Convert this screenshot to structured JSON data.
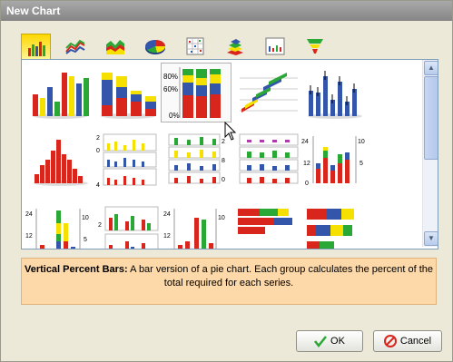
{
  "window": {
    "title": "New Chart"
  },
  "tabs": [
    {
      "name": "bar-chart-icon",
      "active": true
    },
    {
      "name": "line-chart-icon"
    },
    {
      "name": "area-chart-icon"
    },
    {
      "name": "pie-chart-icon"
    },
    {
      "name": "scatter-chart-icon"
    },
    {
      "name": "stock-chart-icon"
    },
    {
      "name": "range-chart-icon"
    },
    {
      "name": "funnel-chart-icon"
    }
  ],
  "gallery": {
    "selected_label_80": "80%",
    "selected_label_60": "60%",
    "selected_label_0": "0%",
    "multi_label_2": "2",
    "multi_label_0": "0",
    "multi_label_4": "4",
    "multi_label_8": "8",
    "multi_label_24": "24",
    "multi_label_12": "12",
    "multi_label_10": "10",
    "multi_label_5": "5"
  },
  "description": {
    "heading": "Vertical Percent Bars:",
    "text": "A bar version of a pie chart. Each group calculates the percent of the total required for each series."
  },
  "buttons": {
    "ok": "OK",
    "cancel": "Cancel"
  },
  "colors": {
    "red": "#d9261c",
    "blue": "#3355aa",
    "yellow": "#f5e000",
    "green": "#2aa836",
    "accent": "#ffd700"
  }
}
